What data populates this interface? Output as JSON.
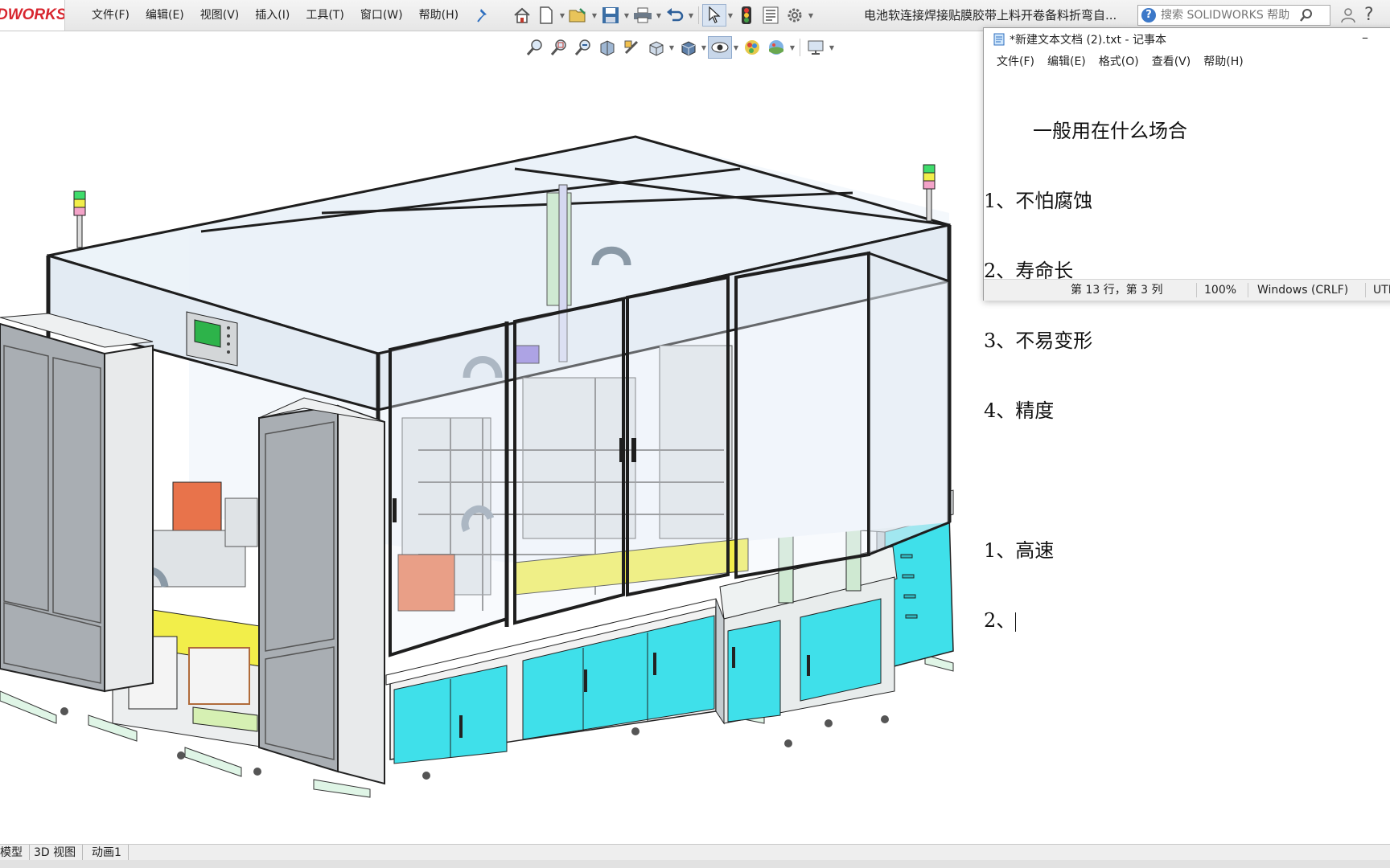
{
  "solidworks": {
    "logo": "DWORKS",
    "menu": [
      "文件(F)",
      "编辑(E)",
      "视图(V)",
      "插入(I)",
      "工具(T)",
      "窗口(W)",
      "帮助(H)"
    ],
    "doc_title": "电池软连接焊接贴膜胶带上料开卷备料折弯自...",
    "search_placeholder": "搜索 SOLIDWORKS 帮助",
    "help_label": "?",
    "toolbar_icons": [
      "home-icon",
      "new-document-icon",
      "open-icon",
      "save-icon",
      "print-icon",
      "undo-icon",
      "select-icon",
      "rebuild-icon",
      "file-properties-icon",
      "options-icon"
    ],
    "view_toolbar_icons": [
      "zoom-to-fit-icon",
      "zoom-to-area-icon",
      "previous-view-icon",
      "section-view-icon",
      "dynamic-annotation-icon",
      "view-orientation-icon",
      "display-style-icon",
      "hide-show-items-icon",
      "edit-appearance-icon",
      "apply-scene-icon",
      "view-settings-icon"
    ],
    "bottom_tabs": [
      "模型",
      "3D 视图",
      "动画1"
    ]
  },
  "notepad": {
    "title": "*新建文本文档 (2).txt - 记事本",
    "minimize": "–",
    "menu": [
      "文件(F)",
      "编辑(E)",
      "格式(O)",
      "查看(V)",
      "帮助(H)"
    ],
    "lines": [
      "        一般用在什么场合",
      "1、不怕腐蚀",
      "2、寿命长",
      "3、不易变形",
      "4、精度",
      "",
      "1、高速",
      "2、"
    ],
    "status": {
      "position": "第 13 行，第 3 列",
      "zoom": "100%",
      "line_ending": "Windows (CRLF)",
      "encoding": "UTF"
    }
  },
  "colors": {
    "cabinet_cyan": "#3fe0ea",
    "table_yellow": "#f2ee4a",
    "frame_dark": "#2b2b2b",
    "glass": "#e8f0f8",
    "door_gray": "#a9aeb3",
    "logo_red": "#d8262f"
  }
}
